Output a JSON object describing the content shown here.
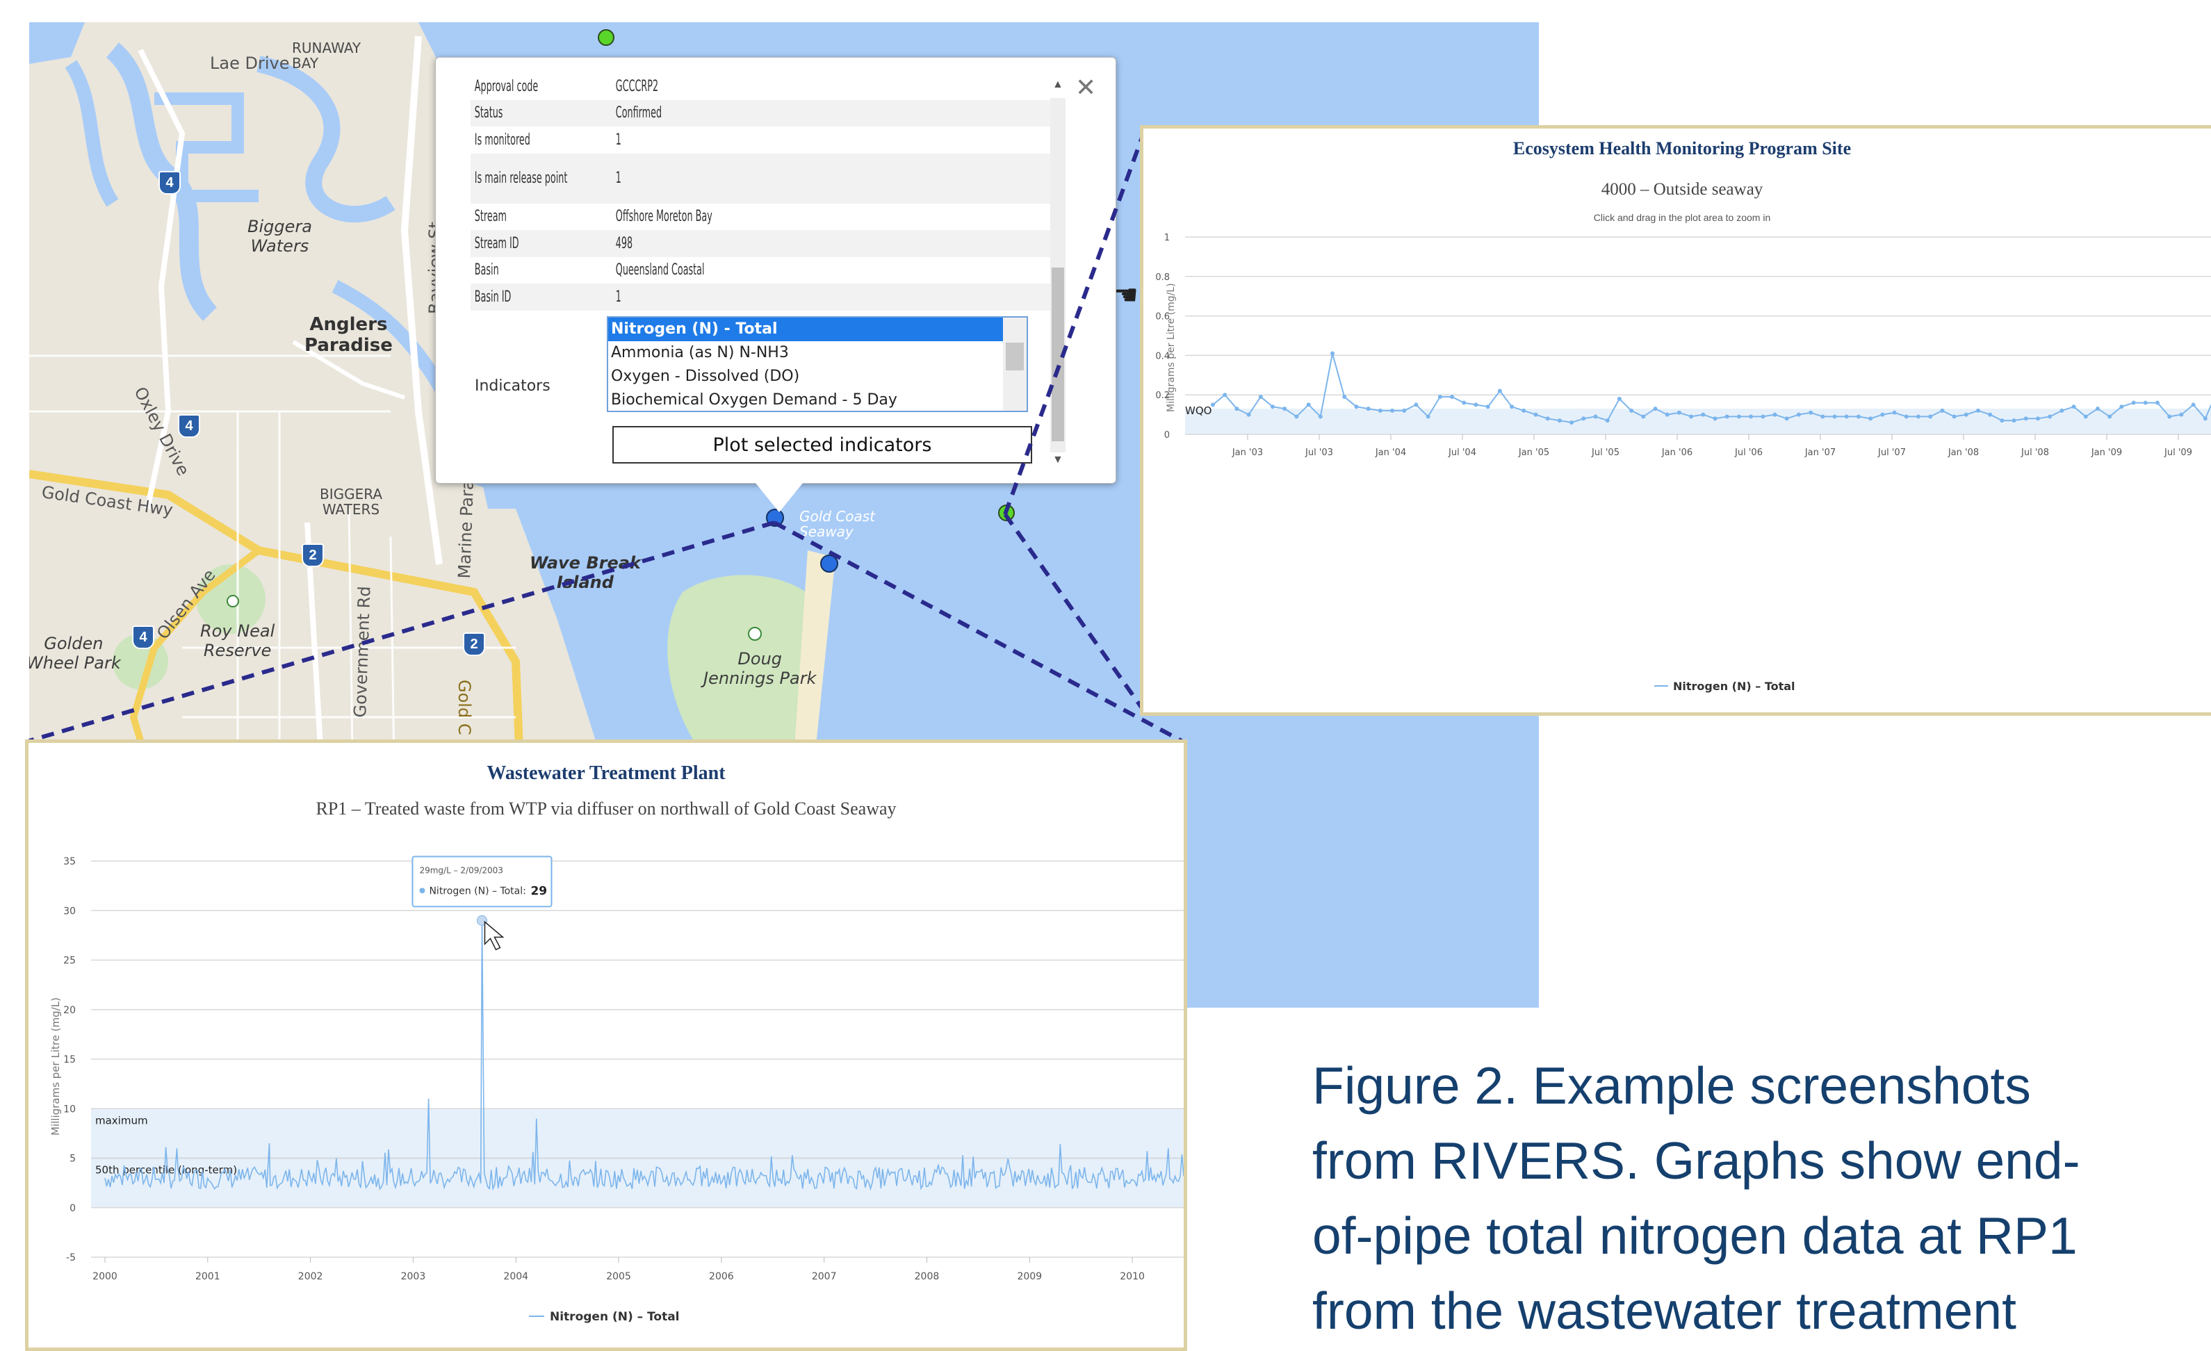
{
  "map": {
    "labels": {
      "lae_drive": "Lae Drive",
      "runaway_bay": "RUNAWAY\nBAY",
      "biggera_waters_it": "Biggera\nWaters",
      "anglers_paradise": "Anglers\nParadise",
      "oxley_drive": "Oxley Drive",
      "bayview_st": "Bayview St",
      "gold_coast_hwy": "Gold Coast Hwy",
      "biggera_waters_caps": "BIGGERA\nWATERS",
      "olsen_ave": "Olsen Ave",
      "roy_neal_reserve": "Roy Neal\nReserve",
      "government_rd": "Government Rd",
      "marine_parade": "Marine Parade",
      "wave_break_island": "Wave Break\nIsland",
      "gold_coast_seaway": "Gold Coast\nSeaway",
      "doug_jennings_park": "Doug\nJennings Park",
      "golden_wheel_park": "Golden\nWheel Park",
      "gold_c": "Gold C"
    },
    "shields": [
      "4",
      "4",
      "4",
      "2",
      "4",
      "2"
    ]
  },
  "popup": {
    "rows": [
      {
        "key": "Approval code",
        "value": "GCCCRP2"
      },
      {
        "key": "Status",
        "value": "Confirmed"
      },
      {
        "key": "Is monitored",
        "value": "1"
      },
      {
        "key": "Is main release point",
        "value": "1"
      },
      {
        "key": "Stream",
        "value": "Offshore Moreton Bay"
      },
      {
        "key": "Stream ID",
        "value": "498"
      },
      {
        "key": "Basin",
        "value": "Queensland Coastal"
      },
      {
        "key": "Basin ID",
        "value": "1"
      }
    ],
    "indicators_label": "Indicators",
    "indicators": [
      "Nitrogen (N) - Total",
      "Ammonia (as N) N-NH3",
      "Oxygen - Dissolved (DO)",
      "Biochemical Oxygen Demand - 5 Day"
    ],
    "selected_indicator": 0,
    "plot_button": "Plot selected indicators",
    "close_icon": "close-icon"
  },
  "chart_data": [
    {
      "type": "line",
      "title": "Ecosystem Health Monitoring Program Site",
      "subtitle": "4000 – Outside seaway",
      "hint": "Click and drag in the plot area to zoom in",
      "ylabel": "Milligrams per Litre (mg/L)",
      "ylim": [
        0,
        1
      ],
      "yticks": [
        "0",
        "0.2",
        "0.4",
        "0.6",
        "0.8",
        "1"
      ],
      "xticks": [
        "Jan '03",
        "Jul '03",
        "Jan '04",
        "Jul '04",
        "Jan '05",
        "Jul '05",
        "Jan '06",
        "Jul '06",
        "Jan '07",
        "Jul '07",
        "Jan '08",
        "Jul '08",
        "Jan '09",
        "Jul '09"
      ],
      "band_label": "WQO",
      "band": [
        0,
        0.13
      ],
      "legend": "Nitrogen (N) – Total",
      "series": [
        {
          "name": "Nitrogen (N) – Total",
          "values": [
            0.15,
            0.2,
            0.13,
            0.1,
            0.19,
            0.14,
            0.13,
            0.09,
            0.15,
            0.09,
            0.41,
            0.19,
            0.14,
            0.13,
            0.12,
            0.12,
            0.12,
            0.15,
            0.09,
            0.19,
            0.19,
            0.16,
            0.15,
            0.14,
            0.22,
            0.14,
            0.12,
            0.1,
            0.08,
            0.07,
            0.06,
            0.08,
            0.09,
            0.07,
            0.18,
            0.12,
            0.09,
            0.13,
            0.1,
            0.11,
            0.09,
            0.1,
            0.08,
            0.09,
            0.09,
            0.09,
            0.09,
            0.1,
            0.08,
            0.1,
            0.11,
            0.09,
            0.09,
            0.09,
            0.09,
            0.08,
            0.1,
            0.11,
            0.09,
            0.09,
            0.09,
            0.12,
            0.09,
            0.1,
            0.12,
            0.1,
            0.07,
            0.07,
            0.08,
            0.08,
            0.09,
            0.12,
            0.14,
            0.09,
            0.13,
            0.09,
            0.14,
            0.16,
            0.16,
            0.16,
            0.09,
            0.1,
            0.15,
            0.08,
            0.22
          ]
        }
      ]
    },
    {
      "type": "line",
      "title": "Wastewater Treatment Plant",
      "subtitle": "RP1 – Treated waste from WTP via diffuser on northwall of Gold Coast Seaway",
      "ylabel": "Milligrams per Litre (mg/L)",
      "ylim": [
        -5,
        35
      ],
      "yticks": [
        "-5",
        "0",
        "5",
        "10",
        "15",
        "20",
        "25",
        "30",
        "35"
      ],
      "xticks": [
        "2000",
        "2001",
        "2002",
        "2003",
        "2004",
        "2005",
        "2006",
        "2007",
        "2008",
        "2009",
        "2010"
      ],
      "band_max_label": "maximum",
      "band_max": 10,
      "band_p50_label": "50th percentile (long-term)",
      "band_p50": 5,
      "legend": "Nitrogen (N) – Total",
      "tooltip": {
        "line1": "29mg/L – 2/09/2003",
        "series": "Nitrogen (N) – Total:",
        "value": "29"
      },
      "series": [
        {
          "name": "Nitrogen (N) – Total",
          "x_start": 2000,
          "x_end": 2010.5,
          "peak": {
            "x": 2003.67,
            "y": 29
          },
          "secondary_peaks": [
            {
              "x": 2003.15,
              "y": 11
            },
            {
              "x": 2004.2,
              "y": 9
            },
            {
              "x": 2001.6,
              "y": 6.5
            },
            {
              "x": 2000.7,
              "y": 6
            },
            {
              "x": 2010.35,
              "y": 6
            }
          ],
          "baseline": 3
        }
      ]
    }
  ],
  "caption": [
    "Figure 2. Example screenshots",
    "from  RIVERS. Graphs show end-",
    "of-pipe total nitrogen data  at RP1",
    "from the wastewater treatment"
  ],
  "colors": {
    "line": "#7cb5ec",
    "band": "#e6f0fa",
    "title": "#1c3d6e",
    "caption": "#15406e",
    "dash": "#2a2a8c"
  }
}
